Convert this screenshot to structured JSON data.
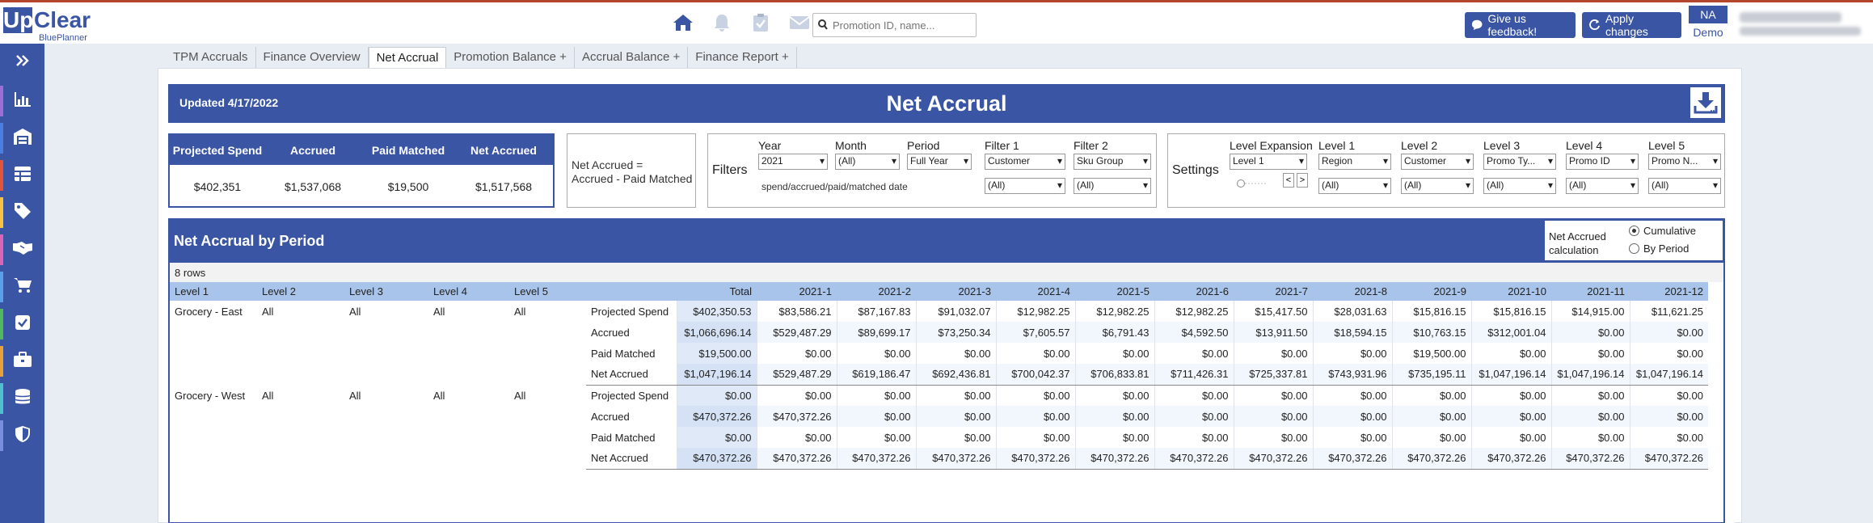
{
  "app": {
    "logo_up": "Up",
    "logo_clear": "Clear",
    "logo_sub": "BluePlanner",
    "search_placeholder": "Promotion ID, name...",
    "feedback_label": "Give us feedback!",
    "apply_label": "Apply changes",
    "user_initials": "NA",
    "user_env": "Demo"
  },
  "sidebar": {
    "items": [
      {
        "icon": "chevron-double-right-icon",
        "stripe": ""
      },
      {
        "icon": "bar-chart-icon",
        "stripe": "#9b6fd6"
      },
      {
        "icon": "warehouse-icon",
        "stripe": "#4a7fe0"
      },
      {
        "icon": "table-icon",
        "stripe": "#e0553a"
      },
      {
        "icon": "tag-icon",
        "stripe": "#f5c242"
      },
      {
        "icon": "handshake-icon",
        "stripe": "#d965b8"
      },
      {
        "icon": "cart-icon",
        "stripe": "#5a9fe8"
      },
      {
        "icon": "checkbox-icon",
        "stripe": "#52b85e"
      },
      {
        "icon": "briefcase-icon",
        "stripe": "#e8a03a"
      },
      {
        "icon": "database-icon",
        "stripe": "#4fc0d0"
      },
      {
        "icon": "shield-icon",
        "stripe": "#7a8ee0"
      }
    ]
  },
  "tabs": [
    {
      "label": "TPM Accruals",
      "active": false
    },
    {
      "label": "Finance Overview",
      "active": false
    },
    {
      "label": "Net Accrual",
      "active": true
    },
    {
      "label": "Promotion Balance +",
      "active": false
    },
    {
      "label": "Accrual Balance +",
      "active": false
    },
    {
      "label": "Finance Report +",
      "active": false
    }
  ],
  "banner": {
    "updated": "Updated 4/17/2022",
    "title": "Net Accrual"
  },
  "kpi": {
    "headers": [
      "Projected Spend",
      "Accrued",
      "Paid Matched",
      "Net Accrued"
    ],
    "values": [
      "$402,351",
      "$1,537,068",
      "$19,500",
      "$1,517,568"
    ]
  },
  "formula": {
    "line1": "Net Accrued =",
    "line2": "Accrued - Paid Matched"
  },
  "filters": {
    "label": "Filters",
    "year_label": "Year",
    "year_value": "2021",
    "month_label": "Month",
    "month_value": "(All)",
    "period_label": "Period",
    "period_value": "Full Year",
    "filter1_label": "Filter 1",
    "filter1_value": "Customer",
    "filter1_sub": "(All)",
    "filter2_label": "Filter 2",
    "filter2_value": "Sku Group",
    "filter2_sub": "(All)",
    "note": "spend/accrued/paid/matched date"
  },
  "settings": {
    "label": "Settings",
    "expansion_label": "Level Expansion",
    "expansion_value": "Level 1",
    "levels": [
      {
        "label": "Level 1",
        "value": "Region",
        "sub": "(All)"
      },
      {
        "label": "Level 2",
        "value": "Customer",
        "sub": "(All)"
      },
      {
        "label": "Level 3",
        "value": "Promo Ty...",
        "sub": "(All)"
      },
      {
        "label": "Level 4",
        "value": "Promo ID",
        "sub": "(All)"
      },
      {
        "label": "Level 5",
        "value": "Promo N...",
        "sub": "(All)"
      }
    ]
  },
  "panel": {
    "title": "Net Accrual by Period",
    "calc_label_1": "Net Accrued",
    "calc_label_2": "calculation",
    "calc_options": [
      {
        "label": "Cumulative",
        "selected": true
      },
      {
        "label": "By Period",
        "selected": false
      }
    ],
    "row_count": "8 rows"
  },
  "table": {
    "level_headers": [
      "Level 1",
      "Level 2",
      "Level 3",
      "Level 4",
      "Level 5"
    ],
    "total_header": "Total",
    "periods": [
      "2021-1",
      "2021-2",
      "2021-3",
      "2021-4",
      "2021-5",
      "2021-6",
      "2021-7",
      "2021-8",
      "2021-9",
      "2021-10",
      "2021-11",
      "2021-12"
    ],
    "groups": [
      {
        "levels": [
          "Grocery - East",
          "All",
          "All",
          "All",
          "All"
        ],
        "rows": [
          {
            "measure": "Projected Spend",
            "total": "$402,350.53",
            "values": [
              "$83,586.21",
              "$87,167.83",
              "$91,032.07",
              "$12,982.25",
              "$12,982.25",
              "$12,982.25",
              "$15,417.50",
              "$28,031.63",
              "$15,816.15",
              "$15,816.15",
              "$14,915.00",
              "$11,621.25"
            ]
          },
          {
            "measure": "Accrued",
            "total": "$1,066,696.14",
            "values": [
              "$529,487.29",
              "$89,699.17",
              "$73,250.34",
              "$7,605.57",
              "$6,791.43",
              "$4,592.50",
              "$13,911.50",
              "$18,594.15",
              "$10,763.15",
              "$312,001.04",
              "$0.00",
              "$0.00"
            ]
          },
          {
            "measure": "Paid Matched",
            "total": "$19,500.00",
            "values": [
              "$0.00",
              "$0.00",
              "$0.00",
              "$0.00",
              "$0.00",
              "$0.00",
              "$0.00",
              "$0.00",
              "$19,500.00",
              "$0.00",
              "$0.00",
              "$0.00"
            ]
          },
          {
            "measure": "Net Accrued",
            "total": "$1,047,196.14",
            "values": [
              "$529,487.29",
              "$619,186.47",
              "$692,436.81",
              "$700,042.37",
              "$706,833.81",
              "$711,426.31",
              "$725,337.81",
              "$743,931.96",
              "$735,195.11",
              "$1,047,196.14",
              "$1,047,196.14",
              "$1,047,196.14"
            ]
          }
        ]
      },
      {
        "levels": [
          "Grocery - West",
          "All",
          "All",
          "All",
          "All"
        ],
        "rows": [
          {
            "measure": "Projected Spend",
            "total": "$0.00",
            "values": [
              "$0.00",
              "$0.00",
              "$0.00",
              "$0.00",
              "$0.00",
              "$0.00",
              "$0.00",
              "$0.00",
              "$0.00",
              "$0.00",
              "$0.00",
              "$0.00"
            ]
          },
          {
            "measure": "Accrued",
            "total": "$470,372.26",
            "values": [
              "$470,372.26",
              "$0.00",
              "$0.00",
              "$0.00",
              "$0.00",
              "$0.00",
              "$0.00",
              "$0.00",
              "$0.00",
              "$0.00",
              "$0.00",
              "$0.00"
            ]
          },
          {
            "measure": "Paid Matched",
            "total": "$0.00",
            "values": [
              "$0.00",
              "$0.00",
              "$0.00",
              "$0.00",
              "$0.00",
              "$0.00",
              "$0.00",
              "$0.00",
              "$0.00",
              "$0.00",
              "$0.00",
              "$0.00"
            ]
          },
          {
            "measure": "Net Accrued",
            "total": "$470,372.26",
            "values": [
              "$470,372.26",
              "$470,372.26",
              "$470,372.26",
              "$470,372.26",
              "$470,372.26",
              "$470,372.26",
              "$470,372.26",
              "$470,372.26",
              "$470,372.26",
              "$470,372.26",
              "$470,372.26",
              "$470,372.26"
            ]
          }
        ]
      }
    ]
  },
  "colors": {
    "brand": "#3a55a4",
    "header_accent": "#b5462e",
    "table_header": "#a8c4ea"
  }
}
